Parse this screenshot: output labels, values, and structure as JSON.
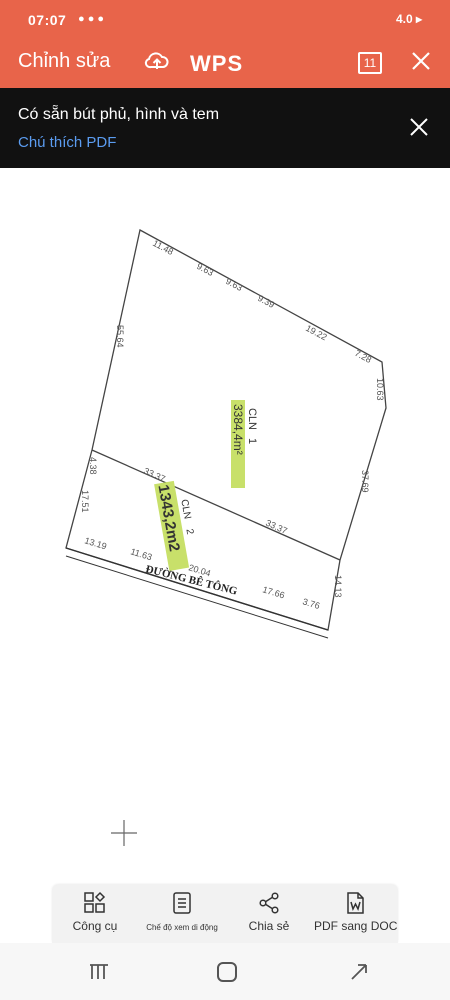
{
  "status_bar": {
    "time": "07:07",
    "right": "4.0 ▸"
  },
  "toolbar": {
    "edit_label": "Chỉnh sửa",
    "logo": "WPS",
    "page_count": "11"
  },
  "banner": {
    "title": "Có sẵn bút phủ, hình và tem",
    "link": "Chú thích PDF"
  },
  "drawing": {
    "dimensions": {
      "top_1": "11.48",
      "top_2": "9.63",
      "top_3": "9.63",
      "top_4": "9.39",
      "top_5": "19.22",
      "top_6": "7.28",
      "right_top": "10.63",
      "right_mid": "37.69",
      "right_bottom": "14.13",
      "left_top": "55.64",
      "left_mid": "4.38",
      "left_bottom": "17.51",
      "mid_left": "33.37",
      "mid_right": "33.37",
      "bottom_1": "13.19",
      "bottom_2": "11.63",
      "bottom_3": "20.04",
      "bottom_4": "17.66",
      "bottom_5": "3.76"
    },
    "parcel_1": {
      "label": "CLN",
      "number": "1",
      "area": "3384,4m²"
    },
    "parcel_2": {
      "label": "CLN",
      "number": "2",
      "area": "1343,2m2"
    },
    "road_label": "ĐƯỜNG BÊ TÔNG",
    "highlight_color": "#c8e06a"
  },
  "bottom_bar": {
    "tools": "Công cụ",
    "mobile_view": "Chế độ xem di động",
    "share": "Chia sẻ",
    "pdf_to_doc": "PDF sang DOC"
  },
  "colors": {
    "accent": "#e8644a",
    "banner": "#111111",
    "link": "#5b9cf0"
  }
}
